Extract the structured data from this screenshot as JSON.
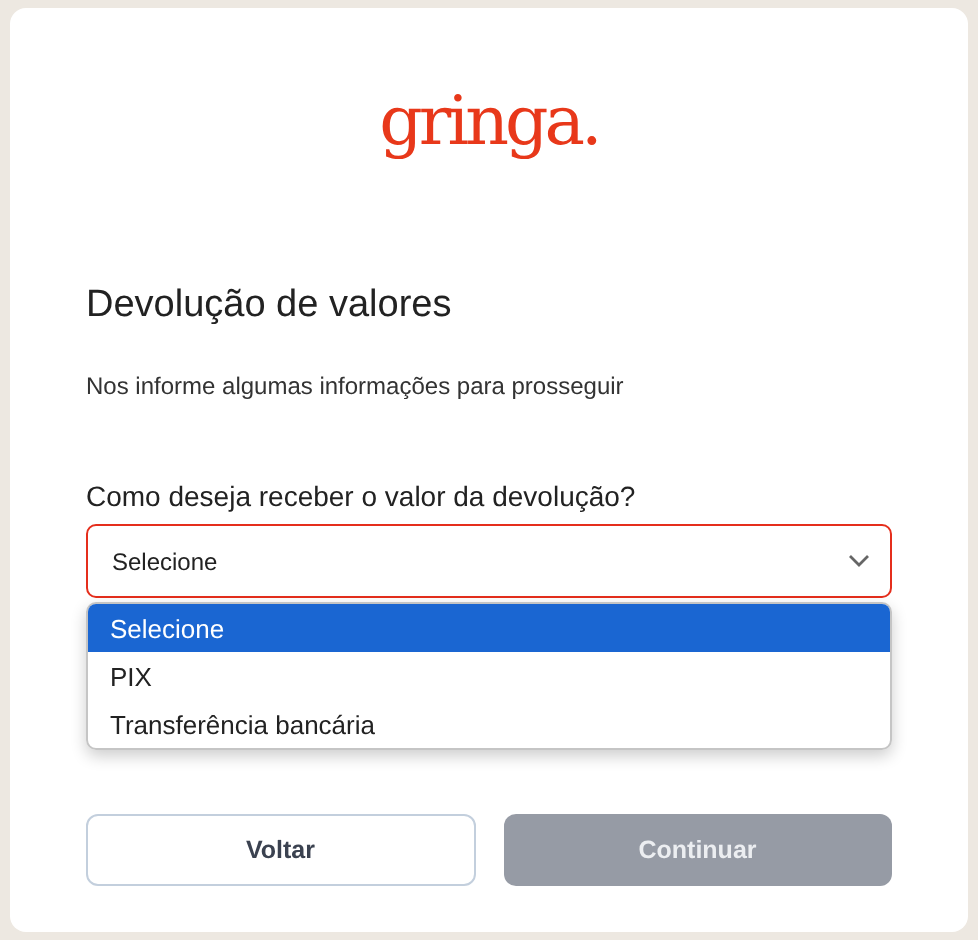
{
  "logo": {
    "text": "gringa."
  },
  "title": "Devolução de valores",
  "subtitle": "Nos informe algumas informações para prosseguir",
  "field": {
    "label": "Como deseja receber o valor da devolução?",
    "value": "Selecione",
    "error": true,
    "expanded": true,
    "options": [
      {
        "label": "Selecione",
        "selected": true
      },
      {
        "label": "PIX",
        "selected": false
      },
      {
        "label": "Transferência bancária",
        "selected": false
      }
    ]
  },
  "buttons": [
    {
      "label": "Voltar",
      "disabled": false,
      "kind": "secondary"
    },
    {
      "label": "Continuar",
      "disabled": true,
      "kind": "primary"
    }
  ]
}
